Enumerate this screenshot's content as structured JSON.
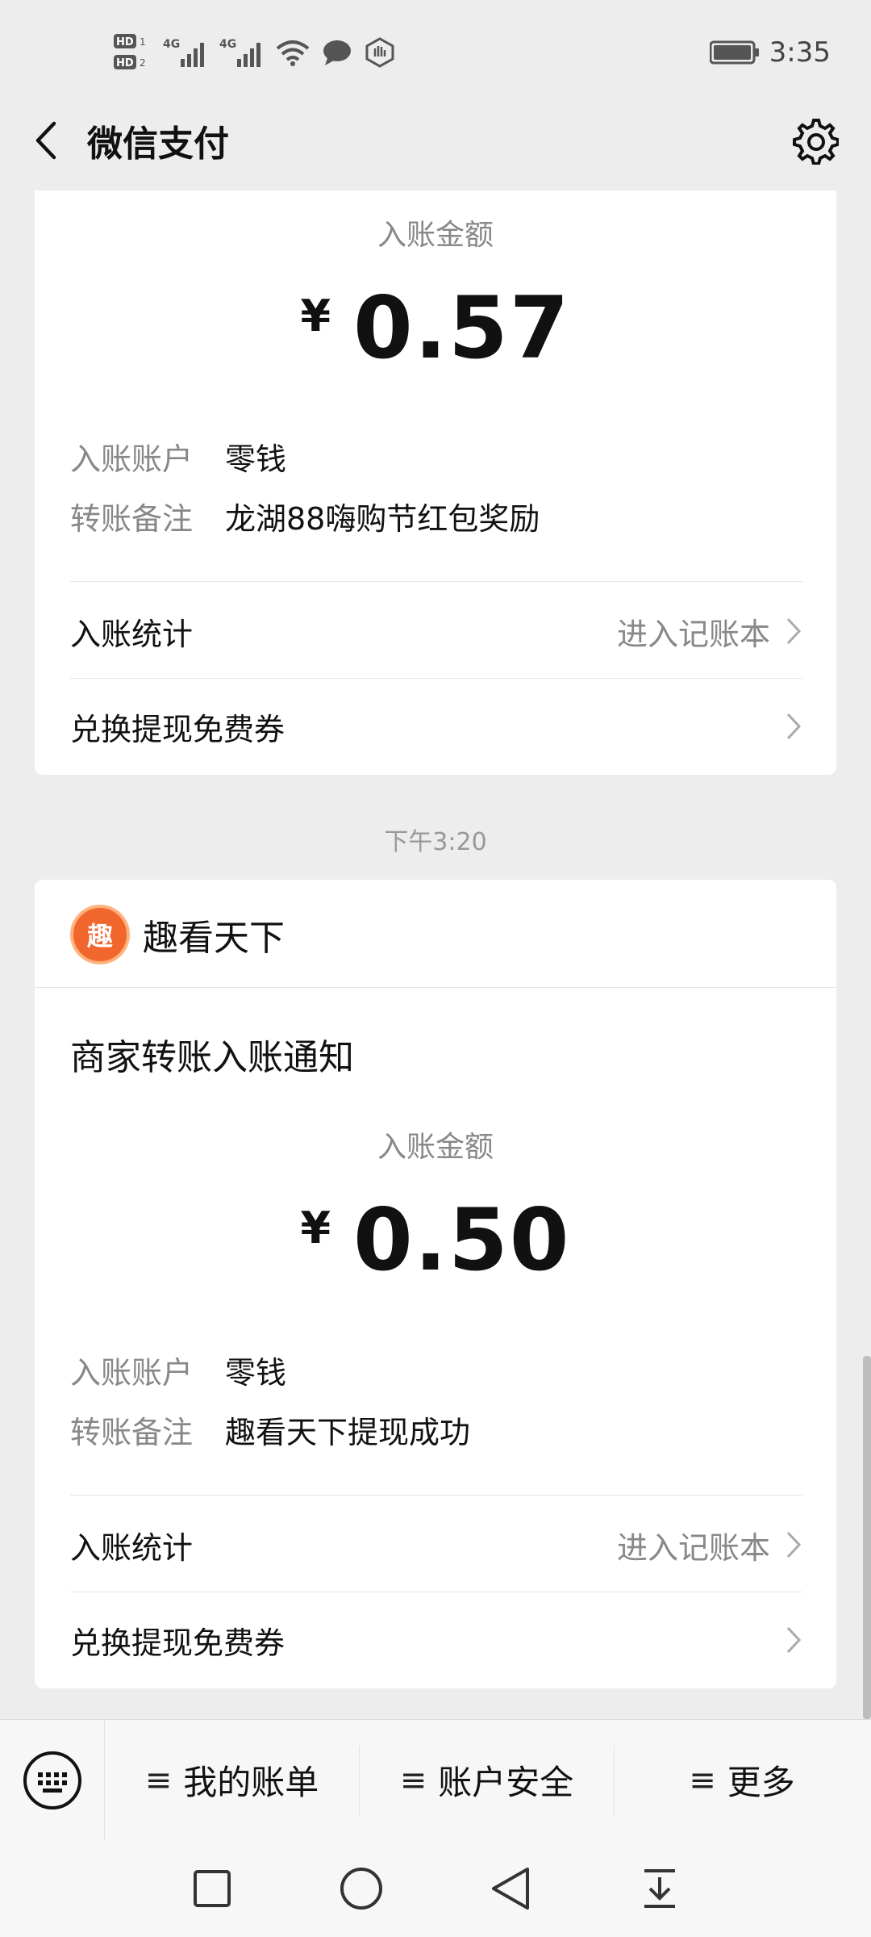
{
  "status": {
    "time": "3:35",
    "network1": "4G",
    "network2": "4G"
  },
  "header": {
    "title": "微信支付"
  },
  "card1": {
    "amount_label": "入账金额",
    "currency": "¥",
    "amount": "0.57",
    "details": [
      {
        "key": "入账账户",
        "value": "零钱"
      },
      {
        "key": "转账备注",
        "value": "龙湖88嗨购节红包奖励"
      }
    ],
    "stats_label": "入账统计",
    "stats_link": "进入记账本",
    "voucher_label": "兑换提现免费券"
  },
  "timestamp": "下午3:20",
  "card2": {
    "merchant_logo_text": "趣",
    "merchant_name": "趣看天下",
    "title": "商家转账入账通知",
    "amount_label": "入账金额",
    "currency": "¥",
    "amount": "0.50",
    "details": [
      {
        "key": "入账账户",
        "value": "零钱"
      },
      {
        "key": "转账备注",
        "value": "趣看天下提现成功"
      }
    ],
    "stats_label": "入账统计",
    "stats_link": "进入记账本",
    "voucher_label": "兑换提现免费券"
  },
  "bottom_menu": {
    "items": [
      {
        "label": "我的账单"
      },
      {
        "label": "账户安全"
      },
      {
        "label": "更多"
      }
    ]
  },
  "icons": {
    "back": "chevron-left-icon",
    "settings": "gear-icon",
    "keyboard": "keyboard-icon",
    "menu": "hamburger-icon"
  },
  "colors": {
    "accent_orange": "#f0662d",
    "background": "#ededed"
  }
}
